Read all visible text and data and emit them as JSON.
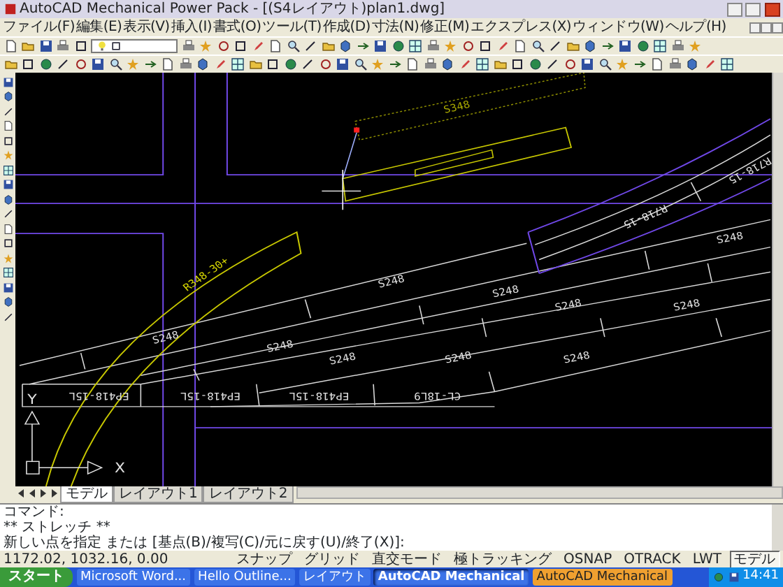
{
  "window": {
    "title": "AutoCAD Mechanical Power Pack - [(S4レイアウト)plan1.dwg]"
  },
  "menu": [
    "ファイル(F)",
    "編集(E)",
    "表示(V)",
    "挿入(I)",
    "書式(O)",
    "ツール(T)",
    "作成(D)",
    "寸法(N)",
    "修正(M)",
    "エクスプレス(X)",
    "ウィンドウ(W)",
    "ヘルプ(H)"
  ],
  "drawing": {
    "labels": [
      {
        "text": "S348",
        "color": "#a8a800"
      },
      {
        "text": "S248",
        "color": "#e0e0e0"
      },
      {
        "text": "S248",
        "color": "#e0e0e0"
      },
      {
        "text": "S248",
        "color": "#e0e0e0"
      },
      {
        "text": "S248",
        "color": "#e0e0e0"
      },
      {
        "text": "S248",
        "color": "#e0e0e0"
      },
      {
        "text": "S248",
        "color": "#e0e0e0"
      },
      {
        "text": "S248",
        "color": "#e0e0e0"
      },
      {
        "text": "S248",
        "color": "#e0e0e0"
      },
      {
        "text": "S248",
        "color": "#e0e0e0"
      },
      {
        "text": "S248",
        "color": "#e0e0e0"
      },
      {
        "text": "R718-15",
        "color": "#e0e0e0"
      },
      {
        "text": "R718-15",
        "color": "#e0e0e0"
      },
      {
        "text": "R348-30+",
        "color": "#d8d800"
      },
      {
        "text": "EP418-15L",
        "color": "#e0e0e0"
      },
      {
        "text": "EP418-15L",
        "color": "#e0e0e0"
      },
      {
        "text": "EP418-15L",
        "color": "#e0e0e0"
      },
      {
        "text": "CL-18L9",
        "color": "#e0e0e0"
      }
    ],
    "ucs": {
      "x_label": "X",
      "y_label": "Y"
    }
  },
  "layout_tabs": [
    {
      "label": "モデル",
      "selected": true
    },
    {
      "label": "レイアウト1",
      "selected": false
    },
    {
      "label": "レイアウト2",
      "selected": false
    }
  ],
  "command_lines": [
    "コマンド:",
    "** ストレッチ **",
    "新しい点を指定 または [基点(B)/複写(C)/元に戻す(U)/終了(X)]:"
  ],
  "status_bar": {
    "coordinates": "1172.02, 1032.16, 0.00",
    "toggles": [
      {
        "label": "スナップ",
        "on": false
      },
      {
        "label": "グリッド",
        "on": false
      },
      {
        "label": "直交モード",
        "on": false
      },
      {
        "label": "極トラッキング",
        "on": false
      },
      {
        "label": "OSNAP",
        "on": false
      },
      {
        "label": "OTRACK",
        "on": false
      },
      {
        "label": "LWT",
        "on": false
      },
      {
        "label": "モデル",
        "on": true
      }
    ]
  },
  "taskbar": {
    "start": "スタート",
    "items": [
      {
        "label": "Microsoft Word...",
        "selected": false,
        "flashing": false
      },
      {
        "label": "Hello Outline...",
        "selected": false,
        "flashing": false
      },
      {
        "label": "レイアウト",
        "selected": false,
        "flashing": false
      },
      {
        "label": "AutoCAD Mechanical",
        "selected": true,
        "flashing": false
      },
      {
        "label": "AutoCAD Mechanical",
        "selected": false,
        "flashing": true
      }
    ],
    "clock": "14:41"
  }
}
